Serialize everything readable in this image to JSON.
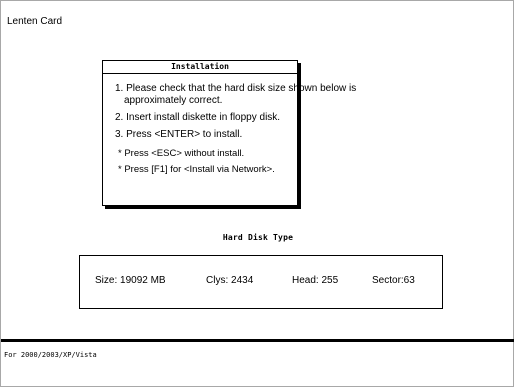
{
  "app": {
    "title": "Lenten Card"
  },
  "installation": {
    "header": "Installation",
    "steps": [
      {
        "line1": "1. Please check that the hard disk size shown below is",
        "line2": "approximately correct."
      },
      {
        "line1": "2. Insert install diskette in floppy disk."
      },
      {
        "line1": "3. Press <ENTER> to install."
      }
    ],
    "notes": [
      "* Press <ESC> without install.",
      "* Press [F1] for <Install via Network>."
    ]
  },
  "hard_disk": {
    "heading": "Hard Disk Type",
    "size_label": "Size:",
    "size_value": "19092 MB",
    "clys_label": "Clys:",
    "clys_value": "2434",
    "head_label": "Head:",
    "head_value": "255",
    "sector_text": "Sector:63"
  },
  "footer": {
    "text": "For 2000/2003/XP/Vista"
  }
}
